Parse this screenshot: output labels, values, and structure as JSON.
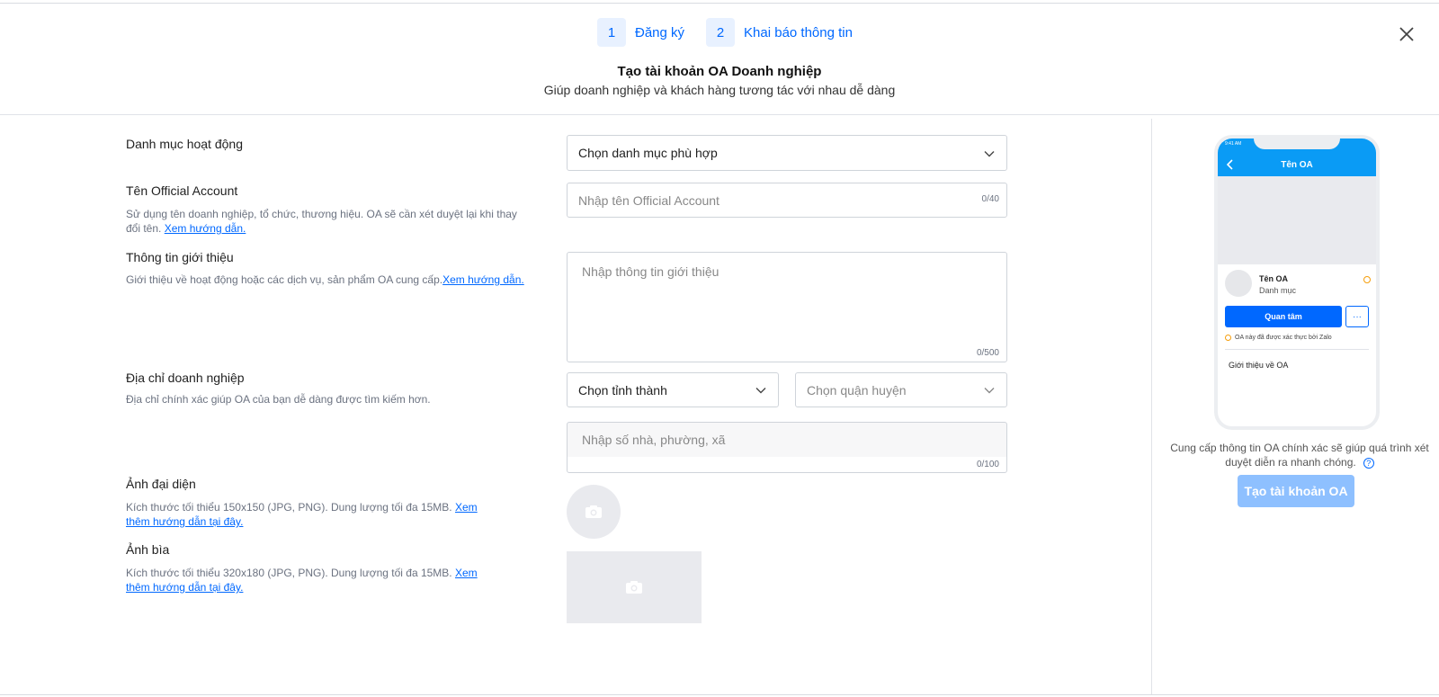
{
  "steps": [
    {
      "num": "1",
      "label": "Đăng ký"
    },
    {
      "num": "2",
      "label": "Khai báo thông tin"
    }
  ],
  "header": {
    "title": "Tạo tài khoản OA Doanh nghiệp",
    "subtitle": "Giúp doanh nghiệp và khách hàng tương tác với nhau dễ dàng"
  },
  "form": {
    "category": {
      "label": "Danh mục hoạt động",
      "value": "Chọn danh mục phù hợp"
    },
    "oa_name": {
      "label": "Tên Official Account",
      "hint": "Sử dụng tên doanh nghiệp, tổ chức, thương hiệu. OA sẽ cần xét duyệt lại khi thay đổi tên.",
      "hint_link": "Xem hướng dẫn.",
      "placeholder": "Nhập tên Official Account",
      "counter": "0/40"
    },
    "intro": {
      "label": "Thông tin giới thiệu",
      "hint": "Giới thiệu về hoạt động hoặc các dịch vụ, sản phẩm OA cung cấp.",
      "hint_link": "Xem hướng dẫn.",
      "placeholder": "Nhập thông tin giới thiệu",
      "counter": "0/500"
    },
    "address": {
      "label": "Địa chỉ doanh nghiệp",
      "hint": "Địa chỉ chính xác giúp OA của bạn dễ dàng được tìm kiếm hơn.",
      "province": "Chọn tỉnh thành",
      "district_placeholder": "Chọn quận huyện",
      "street_placeholder": "Nhập số nhà, phường, xã",
      "counter": "0/100"
    },
    "avatar": {
      "label": "Ảnh đại diện",
      "hint": "Kích thước tối thiểu 150x150 (JPG, PNG). Dung lượng tối đa 15MB.",
      "hint_link": "Xem thêm hướng dẫn tại đây."
    },
    "cover": {
      "label": "Ảnh bìa",
      "hint": "Kích thước tối thiểu 320x180 (JPG, PNG). Dung lượng tối đa 15MB.",
      "hint_link": "Xem thêm hướng dẫn tại đây."
    }
  },
  "preview": {
    "status_time": "9:41 AM",
    "nav_title": "Tên OA",
    "oa_name": "Tên OA",
    "category": "Danh mục",
    "follow_label": "Quan tâm",
    "more_label": "···",
    "verified_text": "OA này đã được xác thực bởi Zalo",
    "about_label": "Giới thiệu về OA",
    "note": "Cung cấp thông tin OA chính xác sẽ giúp quá trình xét duyệt diễn ra nhanh chóng.",
    "help_glyph": "?",
    "create_button": "Tạo tài khoản OA"
  },
  "colors": {
    "accent": "#0068ff",
    "header_blue": "#0a9bf5",
    "disabled_button": "#8ec0ff"
  },
  "icons": [
    "close-icon",
    "chevron-down-icon",
    "camera-icon",
    "back-arrow-icon",
    "help-icon"
  ]
}
